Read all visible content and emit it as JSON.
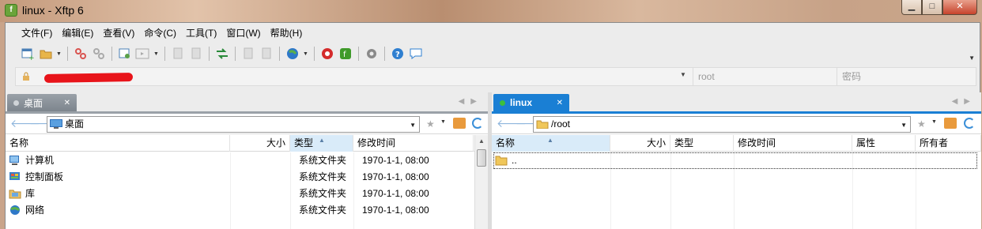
{
  "window": {
    "title": "linux - Xftp 6",
    "app_icon": "xftp-icon",
    "buttons": [
      "minimize",
      "maximize",
      "close"
    ]
  },
  "menu": [
    "文件(F)",
    "编辑(E)",
    "查看(V)",
    "命令(C)",
    "工具(T)",
    "窗口(W)",
    "帮助(H)"
  ],
  "toolbar": {
    "icons": [
      "new-session-icon",
      "open-folder-icon",
      "connect-icon",
      "disconnect-icon",
      "properties-icon",
      "console-icon",
      "copy-icon",
      "paste-icon",
      "transfer-icon",
      "copy2-icon",
      "paste2-icon",
      "globe-icon",
      "xshell-icon",
      "xftp-icon",
      "settings-icon",
      "help-icon",
      "chat-icon"
    ]
  },
  "address": {
    "host_redacted": true,
    "user_placeholder": "root",
    "password_placeholder": "密码"
  },
  "left_pane": {
    "tab_label": "桌面",
    "path": "桌面",
    "columns": [
      "名称",
      "大小",
      "类型",
      "修改时间"
    ],
    "rows": [
      {
        "icon": "computer-icon",
        "name": "计算机",
        "size": "",
        "type": "系统文件夹",
        "modified": "1970-1-1, 08:00"
      },
      {
        "icon": "control-panel-icon",
        "name": "控制面板",
        "size": "",
        "type": "系统文件夹",
        "modified": "1970-1-1, 08:00"
      },
      {
        "icon": "library-icon",
        "name": "库",
        "size": "",
        "type": "系统文件夹",
        "modified": "1970-1-1, 08:00"
      },
      {
        "icon": "network-icon",
        "name": "网络",
        "size": "",
        "type": "系统文件夹",
        "modified": "1970-1-1, 08:00"
      }
    ]
  },
  "right_pane": {
    "tab_label": "linux",
    "path": "/root",
    "columns": [
      "名称",
      "大小",
      "类型",
      "修改时间",
      "属性",
      "所有者"
    ],
    "rows": [
      {
        "icon": "folder-icon",
        "name": "..",
        "size": "",
        "type": "",
        "modified": "",
        "attributes": "",
        "owner": ""
      }
    ]
  },
  "colors": {
    "active_tab": "#1a7fd4",
    "inactive_tab": "#8a9299",
    "sorted_column": "#d9ebf9"
  }
}
